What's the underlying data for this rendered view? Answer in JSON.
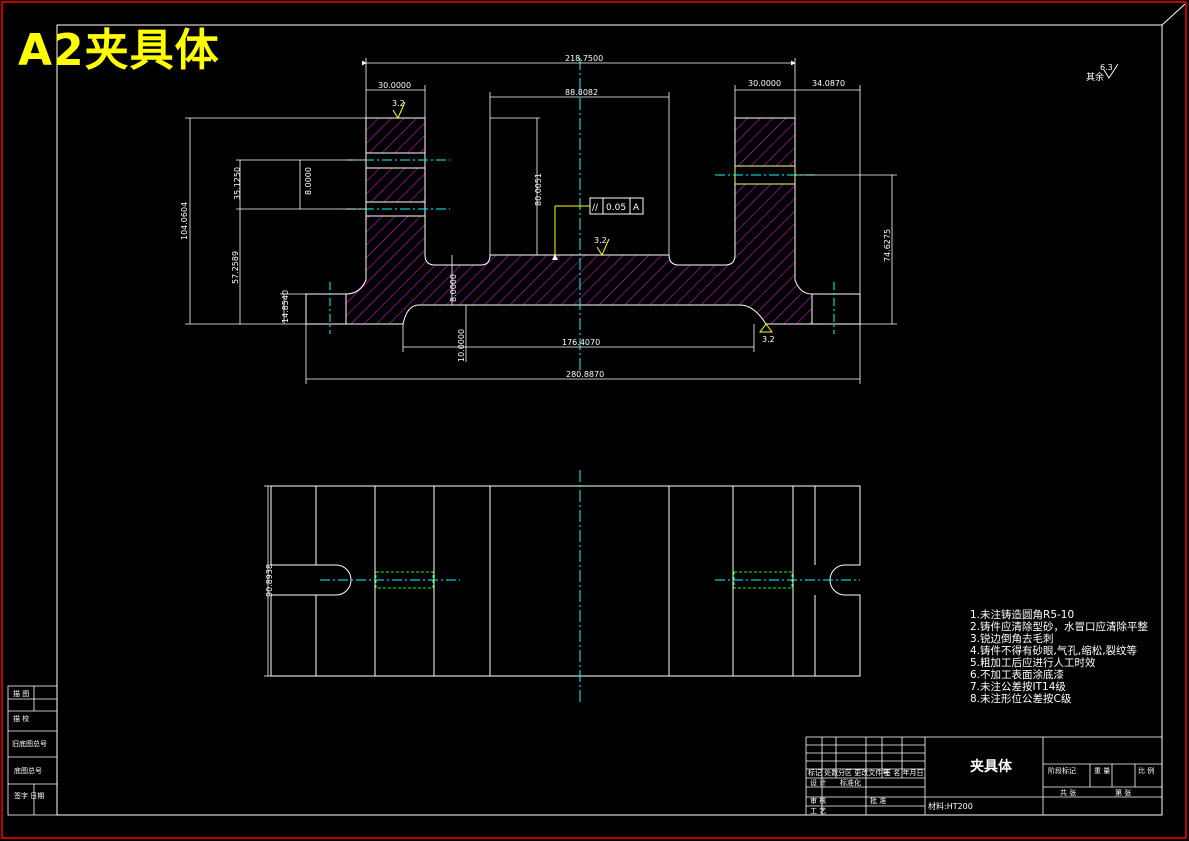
{
  "title_overlay": "A2夹具体",
  "colors": {
    "background": "#000000",
    "frame_outer": "#ff0000",
    "frame_inner": "#ffffff",
    "centerline": "#00ffff",
    "hatch": "#ff00ff",
    "hidden_line": "#00ff00",
    "datum_box": "#ffff00",
    "title_text": "#ffff00"
  },
  "front_view": {
    "dimensions": {
      "overall_top": "218.7500",
      "left_lug": "30.0000",
      "center_gap": "88.8082",
      "right_lug": "30.0000",
      "right_offset": "34.0870",
      "height_total": "104.0604",
      "height_mid": "57.2589",
      "bore_pitch": "35.1250",
      "bore_dia": "8.0000",
      "base_step": "14.8540",
      "slot_depth": "80.0051",
      "floor_thk": "8.0000",
      "lower_gap": "10.0000",
      "bottom_inner": "176.4070",
      "bottom_overall": "280.8870",
      "right_height": "74.6275"
    },
    "roughness_marks": [
      "3.2",
      "3.2",
      "3.2"
    ],
    "tolerance_frame": {
      "symbol": "//",
      "value": "0.05",
      "datum": "A"
    },
    "top_roughness_note": {
      "value": "6.3",
      "label": "其余"
    }
  },
  "top_view": {
    "dimensions": {
      "width": "90.8938"
    }
  },
  "technical_requirements": [
    "1.未注铸造圆角R5-10",
    "2.铸件应清除型砂，水冒口应清除平整",
    "3.锐边倒角去毛刺",
    "4.铸件不得有砂眼,气孔,缩松,裂纹等",
    "5.粗加工后应进行人工时效",
    "6.不加工表面涂底漆",
    "7.未注公差按IT14级",
    "8.未注形位公差按C级"
  ],
  "title_block": {
    "part_name": "夹具体",
    "material": "材料:HT200",
    "left_rows": [
      "标记 处数",
      "设 计",
      "审 核",
      "工 艺"
    ],
    "left_middle": [
      "分区 更改文件号",
      "标准化"
    ],
    "left_right": [
      "签 名 年月日",
      "批 准"
    ],
    "right_header": [
      "阶段标记",
      "重 量",
      "比 例"
    ],
    "right_footer": [
      "共 张",
      "第 张"
    ]
  },
  "side_stamp": {
    "rows": [
      "描 图",
      "描 校",
      "旧底图总号",
      "底图总号",
      "签字 日期"
    ]
  }
}
